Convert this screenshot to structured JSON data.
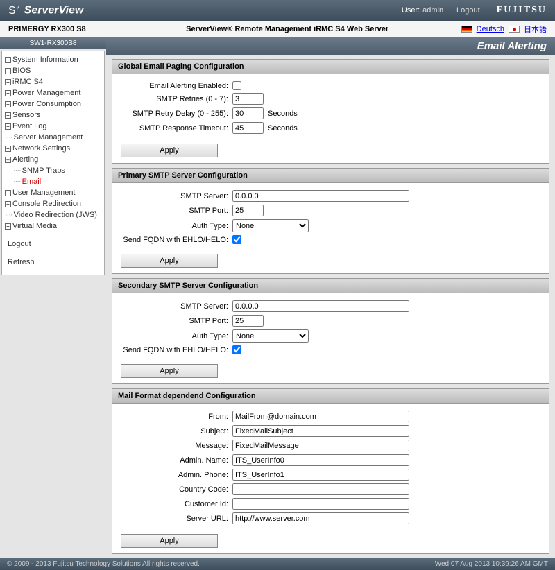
{
  "topbar": {
    "logo": "ServerView",
    "user_label": "User:",
    "user_value": "admin",
    "logout": "Logout",
    "brand": "FUJITSU"
  },
  "subbar": {
    "device": "PRIMERGY RX300 S8",
    "product": "ServerView® Remote Management iRMC S4 Web Server",
    "lang_de": "Deutsch",
    "lang_jp": "日本語"
  },
  "sidebar": {
    "crumb": "SW1-RX300S8",
    "items": {
      "sysinfo": "System Information",
      "bios": "BIOS",
      "irmc": "iRMC S4",
      "power_mgmt": "Power Management",
      "power_cons": "Power Consumption",
      "sensors": "Sensors",
      "eventlog": "Event Log",
      "servermgmt": "Server Management",
      "network": "Network Settings",
      "alerting": "Alerting",
      "snmp": "SNMP Traps",
      "email": "Email",
      "usermgmt": "User Management",
      "console": "Console Redirection",
      "video": "Video Redirection (JWS)",
      "vmedia": "Virtual Media",
      "logout": "Logout",
      "refresh": "Refresh"
    }
  },
  "page": {
    "title": "Email Alerting"
  },
  "global": {
    "heading": "Global Email Paging Configuration",
    "enabled_label": "Email Alerting Enabled:",
    "enabled_checked": false,
    "retries_label": "SMTP Retries (0 - 7):",
    "retries": "3",
    "delay_label": "SMTP Retry Delay (0 - 255):",
    "delay": "30",
    "timeout_label": "SMTP Response Timeout:",
    "timeout": "45",
    "seconds": "Seconds",
    "apply": "Apply"
  },
  "primary": {
    "heading": "Primary SMTP Server Configuration",
    "server_label": "SMTP Server:",
    "server": "0.0.0.0",
    "port_label": "SMTP Port:",
    "port": "25",
    "auth_label": "Auth Type:",
    "auth": "None",
    "fqdn_label": "Send FQDN with EHLO/HELO:",
    "fqdn_checked": true,
    "apply": "Apply"
  },
  "secondary": {
    "heading": "Secondary SMTP Server Configuration",
    "server_label": "SMTP Server:",
    "server": "0.0.0.0",
    "port_label": "SMTP Port:",
    "port": "25",
    "auth_label": "Auth Type:",
    "auth": "None",
    "fqdn_label": "Send FQDN with EHLO/HELO:",
    "fqdn_checked": true,
    "apply": "Apply"
  },
  "mailfmt": {
    "heading": "Mail Format dependend Configuration",
    "from_label": "From:",
    "from": "MailFrom@domain.com",
    "subject_label": "Subject:",
    "subject": "FixedMailSubject",
    "message_label": "Message:",
    "message": "FixedMailMessage",
    "admin_name_label": "Admin. Name:",
    "admin_name": "ITS_UserInfo0",
    "admin_phone_label": "Admin. Phone:",
    "admin_phone": "ITS_UserInfo1",
    "country_label": "Country Code:",
    "country": "",
    "customer_label": "Customer Id:",
    "customer": "",
    "url_label": "Server URL:",
    "url": "http://www.server.com",
    "apply": "Apply"
  },
  "footer": {
    "copyright": "© 2009 - 2013 Fujitsu Technology Solutions All rights reserved.",
    "timestamp": "Wed 07 Aug 2013 10:39:26 AM GMT"
  }
}
